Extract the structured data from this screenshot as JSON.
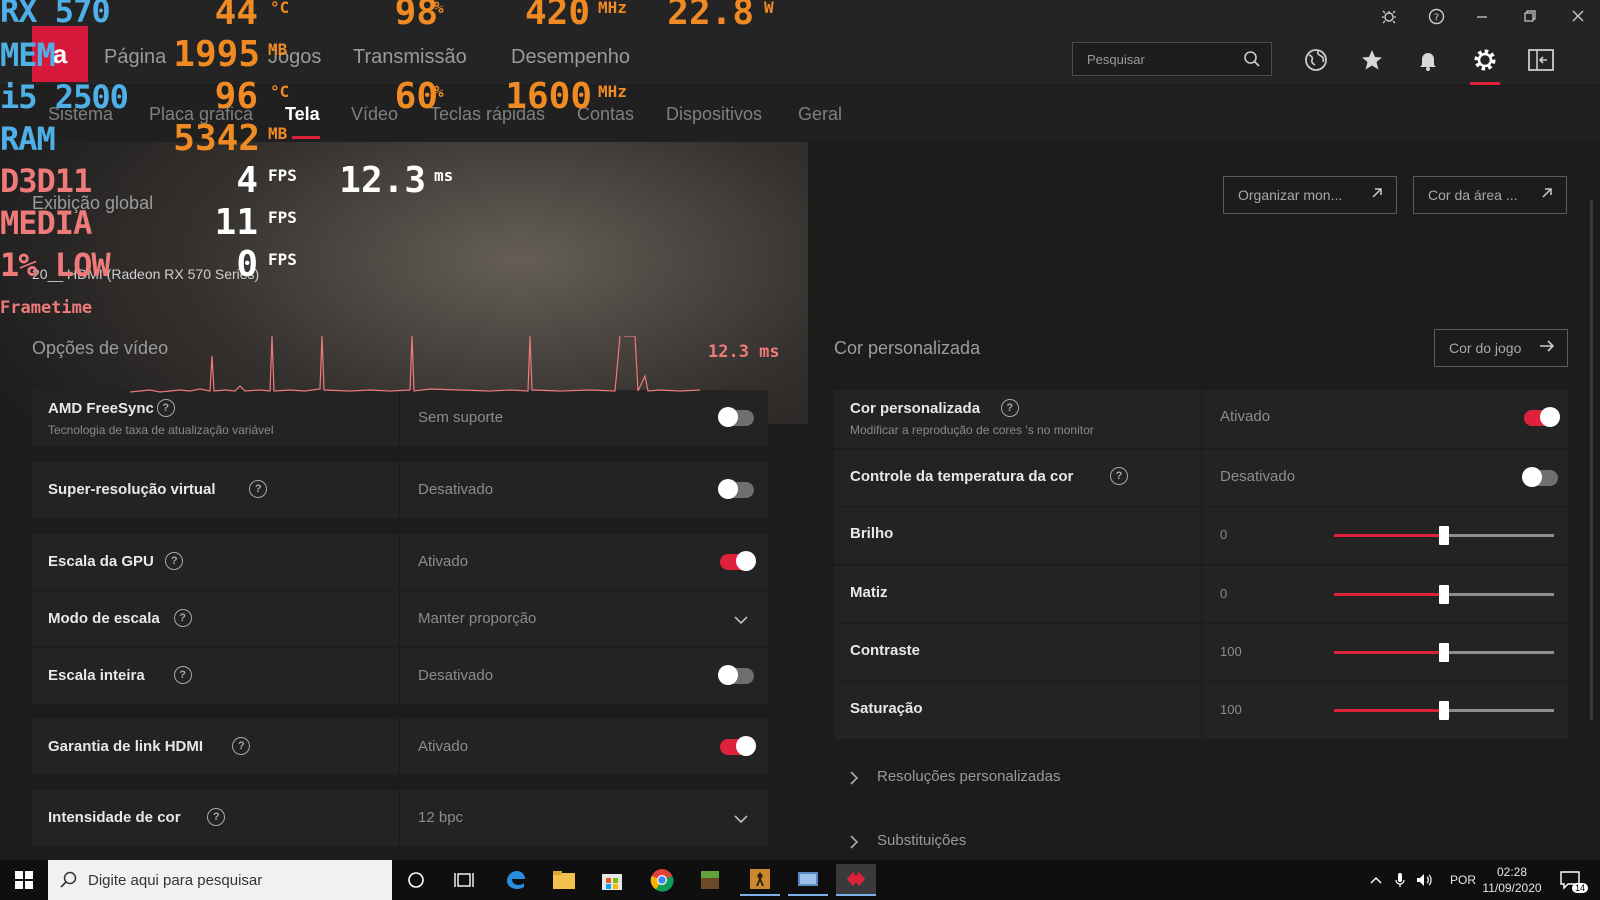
{
  "window": {
    "controls": [
      "bug-icon",
      "help-icon",
      "minimize-icon",
      "restore-icon",
      "close-icon"
    ]
  },
  "topnav": {
    "logo": "a",
    "items": [
      "Página",
      "Jogos",
      "Transmissão",
      "Desempenho"
    ],
    "search_placeholder": "Pesquisar"
  },
  "subnav": {
    "items": [
      "Sistema",
      "Placa gráfica",
      "Tela",
      "Vídeo",
      "Teclas rápidas",
      "Contas",
      "Dispositivos",
      "Geral"
    ],
    "active": "Tela"
  },
  "display": {
    "global_label": "Exibição global",
    "device_label": "20__ HDMI (Radeon RX 570 Series)",
    "buttons": {
      "organize": "Organizar mon...",
      "desktop_color": "Cor da área ...",
      "game_color": "Cor do jogo"
    }
  },
  "video_options": {
    "title": "Opções de vídeo",
    "rows": [
      {
        "label": "AMD FreeSync",
        "sub": "Tecnologia de taxa de atualização variável",
        "value": "Sem suporte",
        "control": "toggle",
        "on": false
      },
      {
        "label": "Super-resolução virtual",
        "value": "Desativado",
        "control": "toggle",
        "on": false
      },
      {
        "label": "Escala da GPU",
        "value": "Ativado",
        "control": "toggle",
        "on": true
      },
      {
        "label": "Modo de escala",
        "value": "Manter proporção",
        "control": "dropdown"
      },
      {
        "label": "Escala inteira",
        "value": "Desativado",
        "control": "toggle",
        "on": false
      },
      {
        "label": "Garantia de link HDMI",
        "value": "Ativado",
        "control": "toggle",
        "on": true
      },
      {
        "label": "Intensidade de cor",
        "value": "12 bpc",
        "control": "dropdown"
      }
    ]
  },
  "custom_color": {
    "title": "Cor personalizada",
    "rows": [
      {
        "label": "Cor personalizada",
        "sub": "Modificar a reprodução de cores 's no monitor",
        "value": "Ativado",
        "control": "toggle",
        "on": true
      },
      {
        "label": "Controle da temperatura da cor",
        "value": "Desativado",
        "control": "toggle",
        "on": false
      },
      {
        "label": "Brilho",
        "value": "0",
        "control": "slider",
        "level": 0.5
      },
      {
        "label": "Matiz",
        "value": "0",
        "control": "slider",
        "level": 0.5
      },
      {
        "label": "Contraste",
        "value": "100",
        "control": "slider",
        "level": 0.5
      },
      {
        "label": "Saturação",
        "value": "100",
        "control": "slider",
        "level": 0.5
      }
    ],
    "expanders": [
      "Resoluções personalizadas",
      "Substituições"
    ]
  },
  "osd": {
    "gpu": {
      "label": "RX 570",
      "load": "44",
      "load_unit": "°C",
      "usage": "98",
      "usage_unit": "%",
      "clock": "420",
      "clock_unit": "MHz",
      "power": "22.8",
      "power_unit": "W"
    },
    "mem": {
      "label": "MEM",
      "value": "1995",
      "unit": "MB"
    },
    "cpu": {
      "label": "i5 2500",
      "temp": "96",
      "temp_unit": "°C",
      "usage": "60",
      "usage_unit": "%",
      "clock": "1600",
      "clock_unit": "MHz"
    },
    "ram": {
      "label": "RAM",
      "value": "5342",
      "unit": "MB"
    },
    "d3d": {
      "label": "D3D11",
      "fps": "4",
      "fps_unit": "FPS",
      "ms": "12.3",
      "ms_unit": "ms"
    },
    "avg": {
      "label": "MEDIA",
      "fps": "11",
      "fps_unit": "FPS"
    },
    "low": {
      "label": "1% LOW",
      "fps": "0",
      "fps_unit": "FPS"
    },
    "frametime": {
      "label": "Frametime",
      "value": "12.3 ms"
    }
  },
  "taskbar": {
    "search_placeholder": "Digite aqui para pesquisar",
    "lang": "POR",
    "time": "02:28",
    "date": "11/09/2020",
    "notifications": "14"
  },
  "colors": {
    "accent": "#e0213c",
    "osd_label": "#4fb0e8",
    "osd_value": "#f08a22"
  }
}
